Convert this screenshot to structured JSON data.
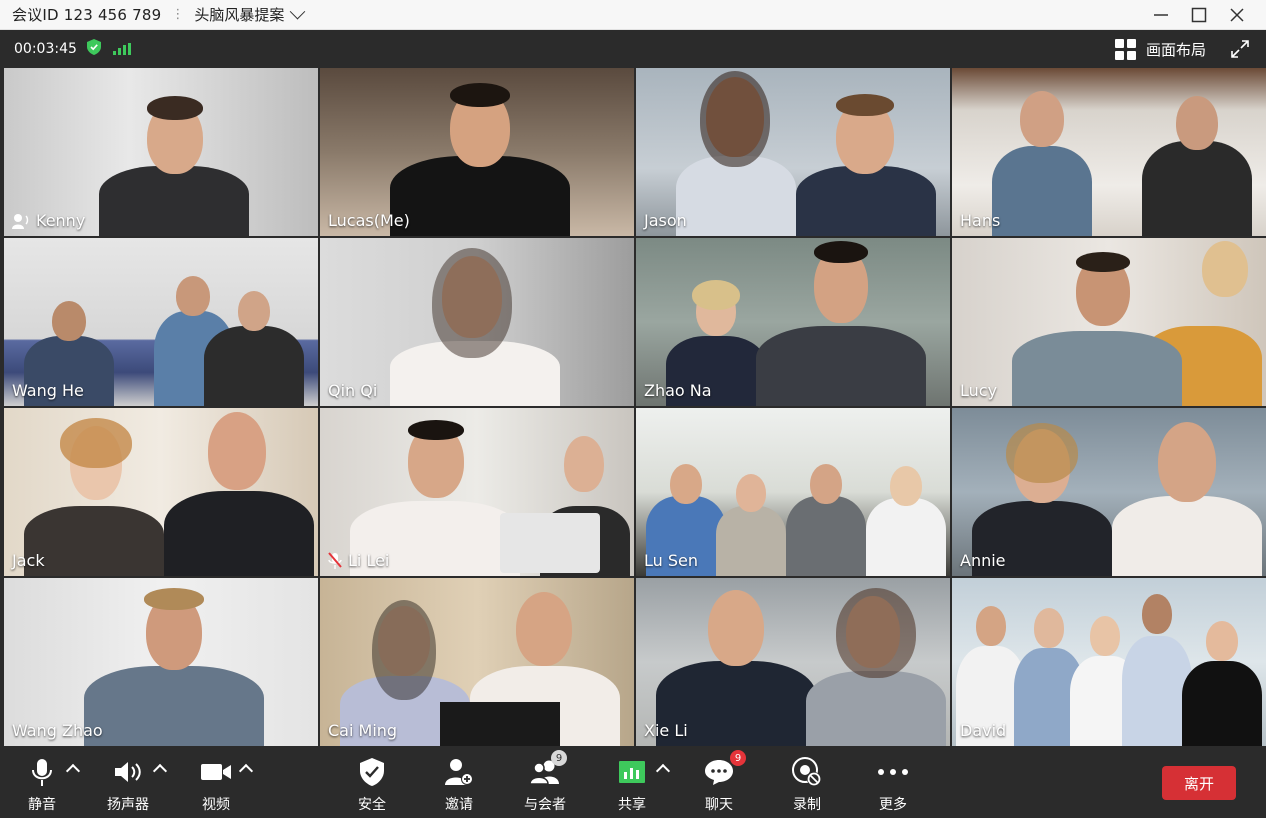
{
  "window": {
    "meeting_id": "会议ID 123 456 789",
    "separator": "⋮",
    "meeting_topic": "头脑风暴提案"
  },
  "status": {
    "elapsed": "00:03:45",
    "layout_label": "画面布局"
  },
  "participants": [
    {
      "name": "Kenny",
      "speaking": true,
      "muted": false
    },
    {
      "name": "Lucas(Me)",
      "speaking": false,
      "muted": false
    },
    {
      "name": "Jason",
      "speaking": false,
      "muted": false
    },
    {
      "name": "Hans",
      "speaking": false,
      "muted": false
    },
    {
      "name": "Wang He",
      "speaking": false,
      "muted": false
    },
    {
      "name": "Qin Qi",
      "speaking": false,
      "muted": false
    },
    {
      "name": "Zhao Na",
      "speaking": false,
      "muted": false
    },
    {
      "name": "Lucy",
      "speaking": false,
      "muted": false
    },
    {
      "name": "Jack",
      "speaking": false,
      "muted": false
    },
    {
      "name": "Li Lei",
      "speaking": false,
      "muted": true
    },
    {
      "name": "Lu Sen",
      "speaking": false,
      "muted": false
    },
    {
      "name": "Annie",
      "speaking": false,
      "muted": false
    },
    {
      "name": "Wang Zhao",
      "speaking": false,
      "muted": false
    },
    {
      "name": "Cai Ming",
      "speaking": false,
      "muted": false
    },
    {
      "name": "Xie Li",
      "speaking": false,
      "muted": false
    },
    {
      "name": "David",
      "speaking": false,
      "muted": false
    }
  ],
  "toolbar": {
    "mute": "静音",
    "speaker": "扬声器",
    "video": "视频",
    "security": "安全",
    "invite": "邀请",
    "participants": "与会者",
    "participants_count": "9",
    "share": "共享",
    "chat": "聊天",
    "chat_unread": "9",
    "record": "录制",
    "more": "更多",
    "leave": "离开"
  },
  "colors": {
    "leave": "#d63035",
    "share_icon": "#3ec95c",
    "signal": "#3ec95c",
    "shield": "#3ec95c"
  }
}
